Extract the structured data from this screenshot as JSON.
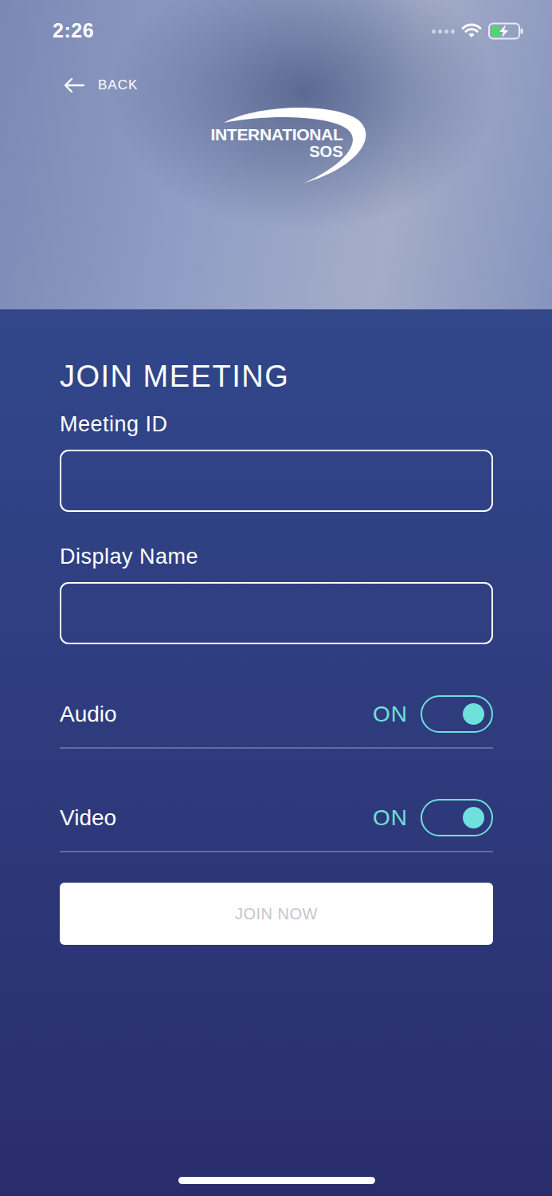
{
  "status_bar": {
    "time": "2:26",
    "battery": {
      "level": 0.3,
      "charging": true
    }
  },
  "nav": {
    "back": "BACK"
  },
  "logo": {
    "line1": "INTERNATIONAL",
    "line2": "SOS"
  },
  "form": {
    "title": "JOIN MEETING",
    "fields": [
      {
        "label": "Meeting ID",
        "value": ""
      },
      {
        "label": "Display Name",
        "value": ""
      }
    ],
    "toggles": [
      {
        "label": "Audio",
        "state_text": "ON",
        "on": true
      },
      {
        "label": "Video",
        "state_text": "ON",
        "on": true
      }
    ],
    "submit": {
      "label": "JOIN NOW",
      "disabled": true
    }
  }
}
